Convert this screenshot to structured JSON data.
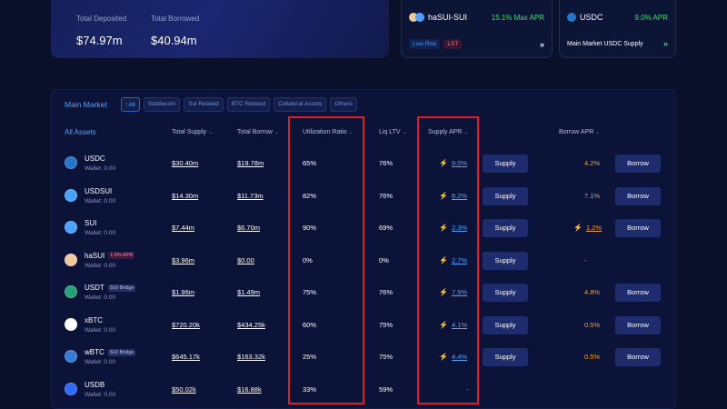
{
  "stats": {
    "total_deposited_label": "Total Deposited",
    "total_deposited_value": "$74.97m",
    "total_borrowed_label": "Total Borrowed",
    "total_borrowed_value": "$40.94m"
  },
  "promos": [
    {
      "token": "haSUI-SUI",
      "apr": "15.1% Max APR",
      "tags": [
        "Low Risk",
        "LST"
      ],
      "icons": [
        "hasui-icon",
        "sui-icon"
      ]
    },
    {
      "token": "USDC",
      "apr": "9.0% APR",
      "subtitle": "Main Market USDC Supply",
      "icons": [
        "usdc-icon"
      ]
    }
  ],
  "market": {
    "title": "Main Market",
    "filters": [
      "All",
      "Stablecoin",
      "Sui Related",
      "BTC Related",
      "Collateral Assets",
      "Others"
    ],
    "active_filter": "All"
  },
  "columns": {
    "assets": "All Assets",
    "total_supply": "Total Supply",
    "total_borrow": "Total Borrow",
    "utilization": "Utilization Ratio",
    "liq_ltv": "Liq LTV",
    "supply_apr": "Supply APR",
    "borrow_apr": "Borrow APR"
  },
  "buttons": {
    "supply": "Supply",
    "borrow": "Borrow"
  },
  "rows": [
    {
      "name": "USDC",
      "wallet": "Wallet: 0.00",
      "badge": "",
      "supply": "$30.40m",
      "borrow": "$19.78m",
      "util": "65%",
      "ltv": "76%",
      "supply_apr": "9.0%",
      "borrow_apr": "4.2%",
      "borrow_apr_style": "orange",
      "has_borrow": true,
      "icon": "usdc-icon",
      "color": "#2775ca"
    },
    {
      "name": "USDSUI",
      "wallet": "Wallet: 0.00",
      "badge": "",
      "supply": "$14.30m",
      "borrow": "$11.73m",
      "util": "82%",
      "ltv": "76%",
      "supply_apr": "8.2%",
      "borrow_apr": "7.1%",
      "borrow_apr_style": "orange",
      "has_borrow": true,
      "icon": "usdsui-icon",
      "color": "#4aa3ff"
    },
    {
      "name": "SUI",
      "wallet": "Wallet: 0.00",
      "badge": "",
      "supply": "$7.44m",
      "borrow": "$6.70m",
      "util": "90%",
      "ltv": "69%",
      "supply_apr": "2.3%",
      "borrow_apr": "1.2%",
      "borrow_apr_style": "link",
      "has_borrow": true,
      "icon": "sui-icon",
      "color": "#4da2ff"
    },
    {
      "name": "haSUI",
      "wallet": "Wallet: 0.00",
      "badge": "1.6% APR",
      "badge_style": "apr",
      "supply": "$3.96m",
      "borrow": "$0.00",
      "util": "0%",
      "ltv": "0%",
      "supply_apr": "2.7%",
      "borrow_apr": "-",
      "borrow_apr_style": "orange",
      "has_borrow": false,
      "icon": "hasui-icon",
      "color": "#f0c7a0"
    },
    {
      "name": "USDT",
      "wallet": "Wallet: 0.00",
      "badge": "SUI Bridge",
      "badge_style": "bridge",
      "supply": "$1.96m",
      "borrow": "$1.49m",
      "util": "75%",
      "ltv": "76%",
      "supply_apr": "7.5%",
      "borrow_apr": "4.8%",
      "borrow_apr_style": "orange",
      "has_borrow": true,
      "icon": "usdt-icon",
      "color": "#26a17b"
    },
    {
      "name": "xBTC",
      "wallet": "Wallet: 0.00",
      "badge": "",
      "supply": "$720.20k",
      "borrow": "$434.25k",
      "util": "60%",
      "ltv": "75%",
      "supply_apr": "4.1%",
      "borrow_apr": "0.5%",
      "borrow_apr_style": "orange",
      "has_borrow": true,
      "icon": "xbtc-icon",
      "color": "#ffffff"
    },
    {
      "name": "wBTC",
      "wallet": "Wallet: 0.00",
      "badge": "SUI Bridge",
      "badge_style": "bridge",
      "supply": "$645.17k",
      "borrow": "$163.32k",
      "util": "25%",
      "ltv": "75%",
      "supply_apr": "4.4%",
      "borrow_apr": "0.5%",
      "borrow_apr_style": "orange",
      "has_borrow": true,
      "icon": "wbtc-icon",
      "color": "#3a7bd5"
    },
    {
      "name": "USDB",
      "wallet": "Wallet: 0.00",
      "badge": "",
      "supply": "$50.02k",
      "borrow": "$16.88k",
      "util": "33%",
      "ltv": "59%",
      "supply_apr": "-",
      "borrow_apr": "",
      "borrow_apr_style": "orange",
      "has_borrow": false,
      "icon": "usdb-icon",
      "color": "#2f6bff"
    }
  ],
  "colors": {
    "accent": "#4ea4ff",
    "highlight": "#e01c2a",
    "apr_green": "#3ee06d",
    "borrow_orange": "#f4a21a"
  }
}
